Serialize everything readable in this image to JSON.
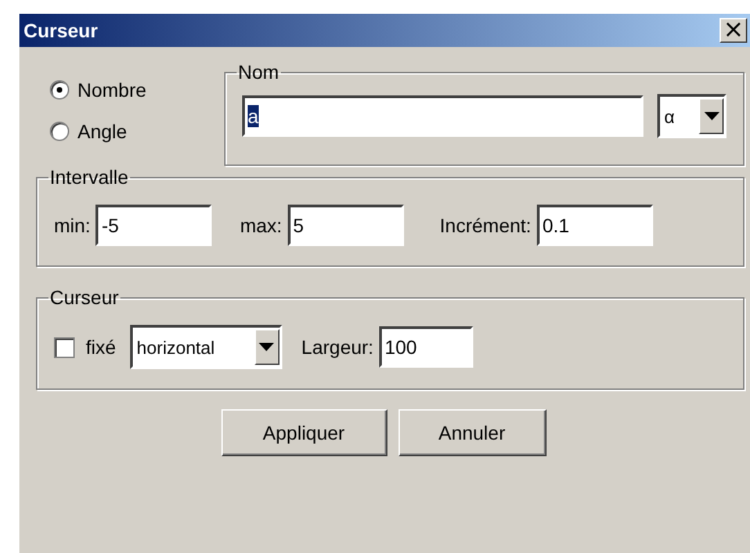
{
  "window": {
    "title": "Curseur",
    "close": "×"
  },
  "type_options": [
    {
      "label": "Nombre",
      "selected": true
    },
    {
      "label": "Angle",
      "selected": false
    }
  ],
  "name_group": {
    "legend": "Nom",
    "value": "a",
    "value_selected": true,
    "symbol": "α"
  },
  "interval_group": {
    "legend": "Intervalle",
    "fields": [
      {
        "label": "min:",
        "value": "-5"
      },
      {
        "label": "max:",
        "value": "5"
      },
      {
        "label": "Incrément:",
        "value": "0.1"
      }
    ]
  },
  "slider_group": {
    "legend": "Curseur",
    "fixed": {
      "label": "fixé",
      "checked": false
    },
    "orientation": "horizontal",
    "width": {
      "label": "Largeur:",
      "value": "100"
    }
  },
  "buttons": [
    "Appliquer",
    "Annuler"
  ]
}
